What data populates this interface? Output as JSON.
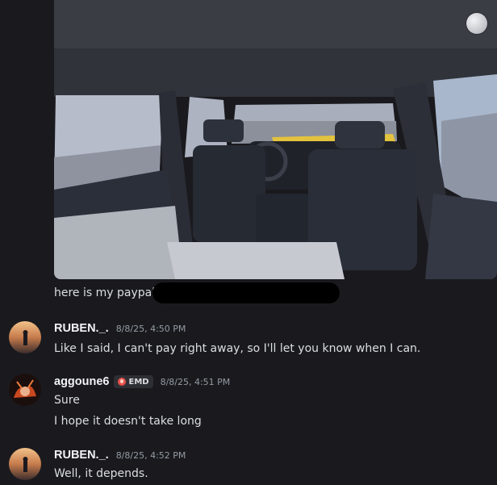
{
  "chat": {
    "image_attachment": {
      "alt": "3D car interior screenshot",
      "icon": "avatar-thumbnail-icon"
    },
    "continuation_text": "here is my paypal",
    "messages": [
      {
        "username": "RUBEN._.",
        "timestamp": "8/8/25, 4:50 PM",
        "lines": [
          "Like I said, I can't pay right away, so I'll let you know when I can."
        ]
      },
      {
        "username": "aggoune6",
        "tag": "EMD",
        "timestamp": "8/8/25, 4:51 PM",
        "lines": [
          "Sure",
          "I hope it doesn't take long"
        ]
      },
      {
        "username": "RUBEN._.",
        "timestamp": "8/8/25, 4:52 PM",
        "lines": [
          "Well, it depends."
        ]
      }
    ]
  },
  "colors": {
    "background": "#1a1a1e",
    "text": "#dbdee1",
    "username": "#f2f3f5",
    "timestamp": "#949ba4",
    "tag_icon": "#e8514a",
    "redaction": "#000000"
  }
}
